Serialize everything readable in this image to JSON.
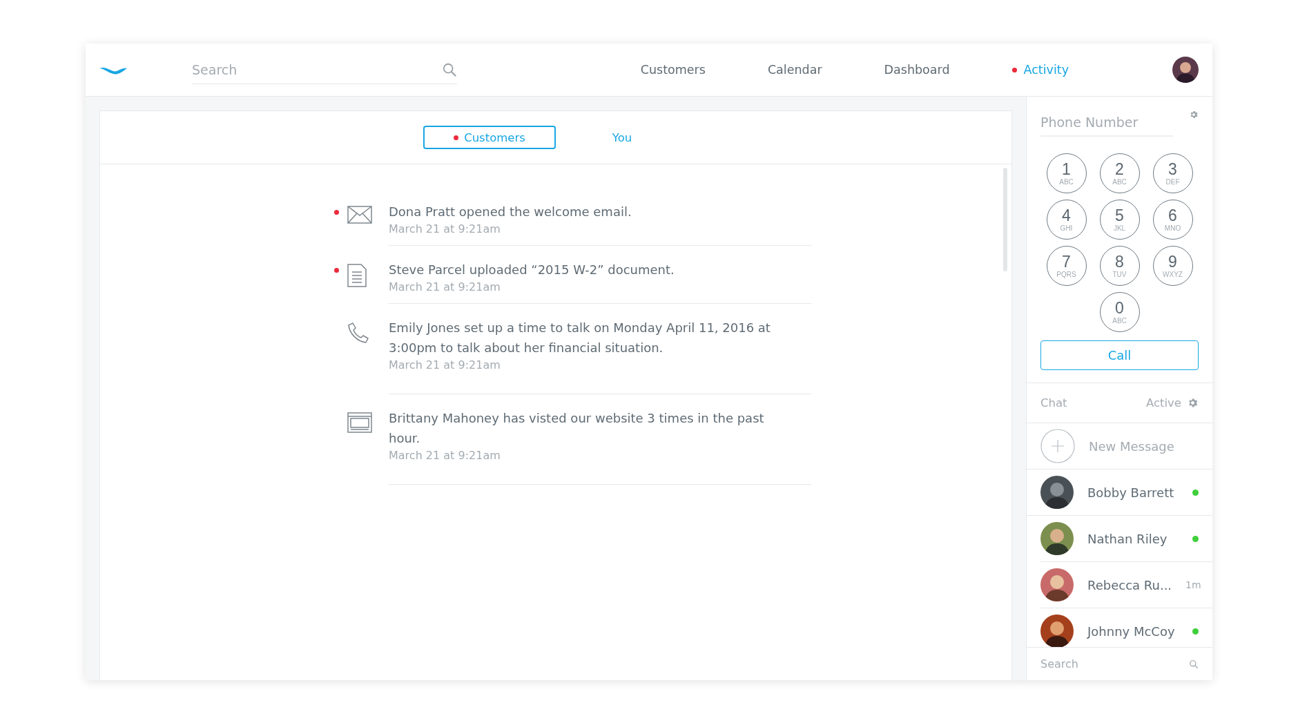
{
  "header": {
    "search": {
      "placeholder": "Search"
    },
    "nav": [
      {
        "label": "Customers",
        "selected": false,
        "unread": false
      },
      {
        "label": "Calendar",
        "selected": false,
        "unread": false
      },
      {
        "label": "Dashboard",
        "selected": false,
        "unread": false
      },
      {
        "label": "Activity",
        "selected": true,
        "unread": true
      }
    ]
  },
  "tabs": [
    {
      "label": "Customers",
      "selected": true,
      "unread": true
    },
    {
      "label": "You",
      "selected": false,
      "unread": false
    }
  ],
  "feed": [
    {
      "kind": "email",
      "unread": true,
      "text": "Dona Pratt opened the welcome email.",
      "time": "March 21 at 9:21am"
    },
    {
      "kind": "document",
      "unread": true,
      "text": "Steve Parcel uploaded “2015 W-2” document.",
      "time": "March 21 at 9:21am"
    },
    {
      "kind": "call",
      "unread": false,
      "text": "Emily Jones set up a time to talk on Monday April 11, 2016 at 3:00pm to talk about her financial situation.",
      "time": "March 21 at 9:21am"
    },
    {
      "kind": "website",
      "unread": false,
      "text": "Brittany Mahoney has visted our website 3 times in the past hour.",
      "time": "March 21 at 9:21am"
    }
  ],
  "dialer": {
    "placeholder": "Phone Number",
    "keys": [
      {
        "digit": "1",
        "letters": "ABC"
      },
      {
        "digit": "2",
        "letters": "ABC"
      },
      {
        "digit": "3",
        "letters": "DEF"
      },
      {
        "digit": "4",
        "letters": "GHI"
      },
      {
        "digit": "5",
        "letters": "JKL"
      },
      {
        "digit": "6",
        "letters": "MNO"
      },
      {
        "digit": "7",
        "letters": "PQRS"
      },
      {
        "digit": "8",
        "letters": "TUV"
      },
      {
        "digit": "9",
        "letters": "WXYZ"
      },
      {
        "digit": "0",
        "letters": "ABC"
      }
    ],
    "call_button": "Call"
  },
  "chat": {
    "title": "Chat",
    "status": "Active",
    "new_message": "New Message",
    "contacts": [
      {
        "name": "Bobby Barrett",
        "online": true,
        "color": "#3fcf3a"
      },
      {
        "name": "Nathan Riley",
        "online": true,
        "color": "#3fcf3a"
      },
      {
        "name": "Rebecca Ru...",
        "online": false,
        "time": "1m"
      },
      {
        "name": "Johnny McCoy",
        "online": true,
        "color": "#3fcf3a"
      }
    ],
    "search": {
      "placeholder": "Search"
    }
  }
}
